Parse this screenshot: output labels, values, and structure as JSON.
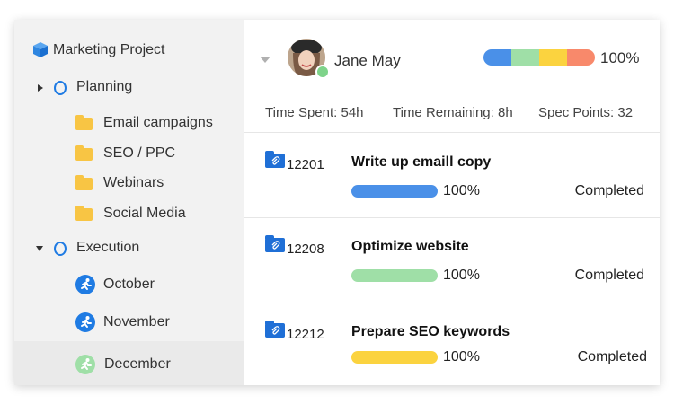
{
  "sidebar": {
    "project": "Marketing Project",
    "groups": [
      {
        "label": "Planning",
        "expanded": false,
        "items": [
          "Email campaigns",
          "SEO / PPC",
          "Webinars",
          "Social Media"
        ]
      },
      {
        "label": "Execution",
        "expanded": true,
        "items": [
          "October",
          "November",
          "December"
        ]
      }
    ],
    "selected_item": "December"
  },
  "header": {
    "user_name": "Jane May",
    "progress_pct": "100%",
    "progress_segments": [
      {
        "color": "#4a90e8",
        "fraction": 0.25
      },
      {
        "color": "#9fdfa7",
        "fraction": 0.25
      },
      {
        "color": "#fbd33f",
        "fraction": 0.25
      },
      {
        "color": "#f8896b",
        "fraction": 0.25
      }
    ],
    "stats": {
      "time_spent": "Time Spent: 54h",
      "time_remaining": "Time Remaining: 8h",
      "spec_points": "Spec Points: 32"
    }
  },
  "tasks": [
    {
      "id": "12201",
      "title": "Write up emaill copy",
      "pct": "100%",
      "status": "Completed",
      "bar_color": "#4a90e8"
    },
    {
      "id": "12208",
      "title": "Optimize website",
      "pct": "100%",
      "status": "Completed",
      "bar_color": "#9fdfa7"
    },
    {
      "id": "12212",
      "title": "Prepare SEO keywords",
      "pct": "100%",
      "status": "Completed",
      "bar_color": "#fbd33f"
    }
  ],
  "colors": {
    "accent": "#1f7be3",
    "folder": "#f8c544",
    "online": "#7ed38a"
  }
}
